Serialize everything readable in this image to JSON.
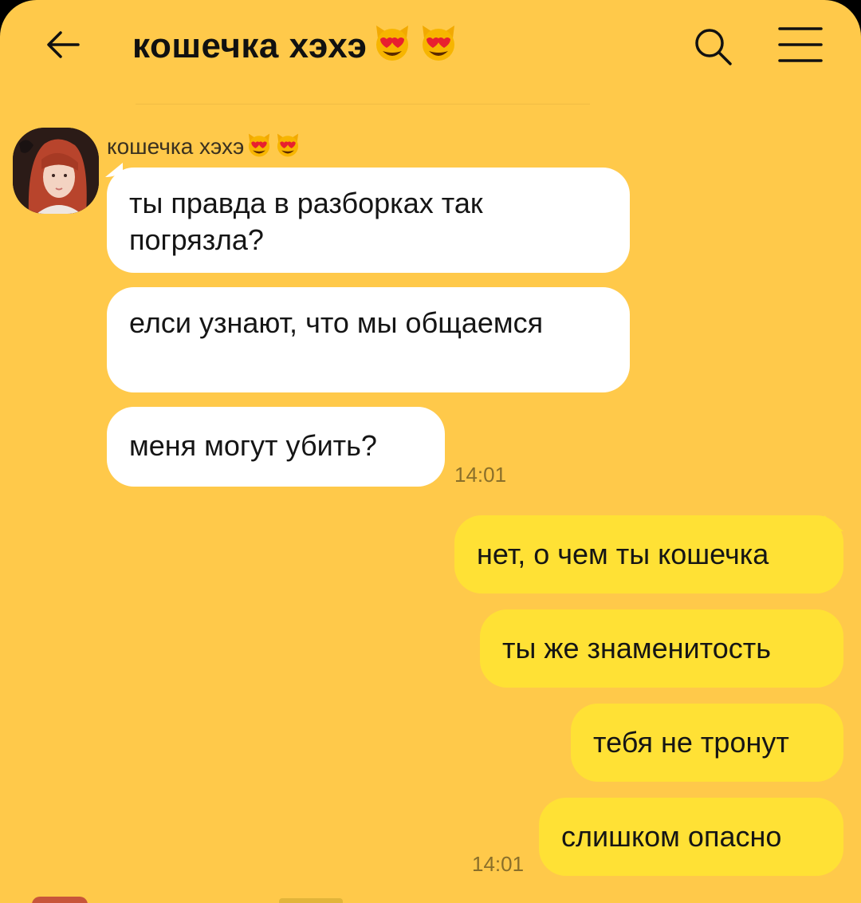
{
  "header": {
    "title": "кошечка хэхэ",
    "title_emojis": [
      "heart-eyes-cat",
      "heart-eyes-cat"
    ],
    "back_icon": "back-arrow-icon",
    "search_icon": "search-icon",
    "menu_icon": "menu-icon"
  },
  "incoming": {
    "sender_name": "кошечка хэхэ",
    "messages": [
      {
        "text": "ты правда в разборках так погрязла?"
      },
      {
        "text": "елси узнают, что мы общаемся"
      },
      {
        "text": "меня могут убить?"
      }
    ],
    "time": "14:01"
  },
  "outgoing": {
    "messages": [
      {
        "text": "нет, о чем ты кошечка"
      },
      {
        "text": "ты же знаменитость"
      },
      {
        "text": "тебя не тронут"
      },
      {
        "text": "слишком опасно"
      }
    ],
    "time": "14:01"
  },
  "colors": {
    "background": "#ffc94a",
    "incoming_bubble": "#ffffff",
    "outgoing_bubble": "#ffe135",
    "text": "#151515"
  }
}
